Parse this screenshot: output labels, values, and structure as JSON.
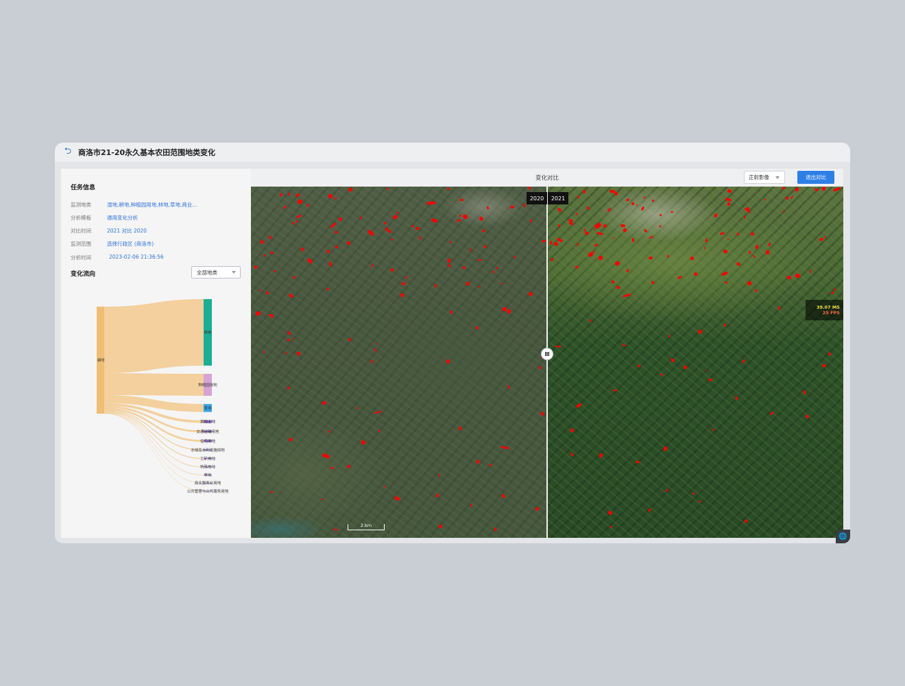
{
  "header": {
    "title": "商洛市21-20永久基本农田范围地类变化"
  },
  "task_info": {
    "section_title": "任务信息",
    "rows": [
      {
        "label": "监测地类",
        "value": "湿地,耕地,种植园用地,林地,草地,商业..."
      },
      {
        "label": "分析模板",
        "value": "通用变化分析"
      },
      {
        "label": "对比时间",
        "value": "2021 对比 2020"
      },
      {
        "label": "监测范围",
        "value": "选择行政区 (商洛市)"
      },
      {
        "label": "分析时间",
        "value": "2023-02-06 21:36:56"
      }
    ]
  },
  "flow": {
    "section_title": "变化流向",
    "filter_value": "全部地类",
    "source": "耕地",
    "targets": [
      {
        "name": "林地",
        "value": 100,
        "color": "#1aae95"
      },
      {
        "name": "种植园用地",
        "value": 33,
        "color": "#d7a3d6"
      },
      {
        "name": "草地",
        "value": 12,
        "color": "#3aa6e8"
      },
      {
        "name": "其他土地",
        "value": 4,
        "color": "#f2c98d"
      },
      {
        "name": "交通运输用地",
        "value": 3,
        "color": "#f2c98d"
      },
      {
        "name": "住宅用地",
        "value": 3,
        "color": "#f2c98d"
      },
      {
        "name": "水域及水利设施用地",
        "value": 1.5,
        "color": "#f2c98d"
      },
      {
        "name": "工矿用地",
        "value": 1.5,
        "color": "#f2c98d"
      },
      {
        "name": "特殊用地",
        "value": 1,
        "color": "#f2c98d"
      },
      {
        "name": "草地",
        "value": 0.8,
        "color": "#f2c98d"
      },
      {
        "name": "商业服务业用地",
        "value": 0.6,
        "color": "#f2c98d"
      },
      {
        "name": "公共管理与公共服务用地",
        "value": 0.5,
        "color": "#f2c98d"
      }
    ]
  },
  "compare": {
    "title": "变化对比",
    "layer_select": "正射影像",
    "exit_label": "退出对比",
    "left_year": "2020",
    "right_year": "2021",
    "handle_glyph": "Ⅲ",
    "scale_label": "2 km",
    "perf_ms": "39.07 MS",
    "perf_fps": "25 FPS",
    "change_color": "#ff0000"
  },
  "icons": {
    "back": "back-arrow-icon",
    "globe": "globe-icon"
  }
}
